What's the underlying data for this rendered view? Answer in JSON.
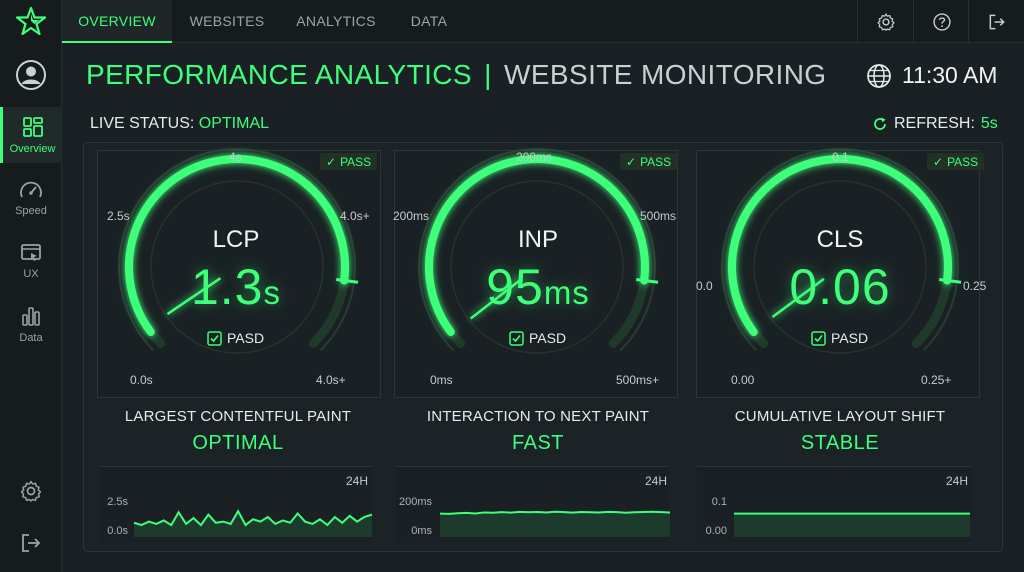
{
  "nav": {
    "tabs": [
      {
        "label": "OVERVIEW",
        "active": true
      },
      {
        "label": "WEBSITES",
        "active": false
      },
      {
        "label": "ANALYTICS",
        "active": false
      },
      {
        "label": "DATA",
        "active": false
      }
    ],
    "icons": [
      "gear-icon",
      "help-icon",
      "logout-icon"
    ]
  },
  "sidebar": {
    "items": [
      {
        "label": "Overview",
        "icon": "dashboard-grid-icon",
        "active": true
      },
      {
        "label": "Speed",
        "icon": "speedometer-icon",
        "active": false
      },
      {
        "label": "UX",
        "icon": "ux-window-icon",
        "active": false
      },
      {
        "label": "Data",
        "icon": "bar-chart-icon",
        "active": false
      }
    ]
  },
  "header": {
    "title_primary": "PERFORMANCE ANALYTICS",
    "separator": "|",
    "title_secondary": "WEBSITE MONITORING",
    "time": "11:30 AM"
  },
  "status": {
    "live_label": "LIVE STATUS:",
    "live_value": "OPTIMAL",
    "refresh_label": "REFRESH:",
    "refresh_value": "5s"
  },
  "gauges": [
    {
      "name": "LCP",
      "value": "1.3",
      "unit": "s",
      "badge": "PASS",
      "pass": "PASD",
      "ticks": {
        "min": "0.0s",
        "left": "2.5s",
        "top": "4s",
        "right": "4.0s+",
        "max": "4.0s+"
      },
      "metric_name": "LARGEST CONTENTFUL PAINT",
      "state": "OPTIMAL",
      "spark": {
        "top": "24H",
        "y_high": "2.5s",
        "y_low": "0.0s",
        "values": [
          1.4,
          1.2,
          1.5,
          1.3,
          1.6,
          1.2,
          2.3,
          1.3,
          1.8,
          1.2,
          2.1,
          1.4,
          1.5,
          1.3,
          2.4,
          1.2,
          1.7,
          1.5,
          1.9,
          1.3,
          1.6,
          1.4,
          2.2,
          1.5,
          1.3,
          1.7,
          1.2,
          1.9,
          1.4,
          2.0,
          1.5,
          1.9,
          2.1
        ]
      },
      "fill": 0.33
    },
    {
      "name": "INP",
      "value": "95",
      "unit": "ms",
      "badge": "PASS",
      "pass": "PASD",
      "ticks": {
        "min": "0ms",
        "left": "200ms",
        "top": "200ms",
        "right": "500ms",
        "max": "500ms+"
      },
      "metric_name": "INTERACTION TO NEXT PAINT",
      "state": "FAST",
      "spark": {
        "top": "24H",
        "y_high": "200ms",
        "y_low": "0ms",
        "values": [
          120,
          118,
          122,
          125,
          121,
          128,
          126,
          130,
          127,
          132,
          129,
          131,
          128,
          133,
          130,
          127,
          131,
          129,
          128,
          132,
          130,
          126,
          129,
          131,
          133,
          130,
          128
        ]
      },
      "fill": 0.19
    },
    {
      "name": "CLS",
      "value": "0.06",
      "unit": "",
      "badge": "PASS",
      "pass": "PASD",
      "ticks": {
        "min": "0.00",
        "left": "0.0",
        "top": "0.1",
        "right": "0.25",
        "max": "0.25+"
      },
      "metric_name": "CUMULATIVE LAYOUT SHIFT",
      "state": "STABLE",
      "spark": {
        "top": "24H",
        "y_high": "0.1",
        "y_low": "0.00",
        "values": [
          0.06,
          0.06,
          0.06,
          0.06,
          0.06,
          0.06,
          0.06,
          0.06,
          0.06,
          0.06
        ]
      },
      "fill": 0.24
    }
  ],
  "colors": {
    "accent": "#3dff7a",
    "background": "#1a2024",
    "panel": "#1c2326"
  }
}
